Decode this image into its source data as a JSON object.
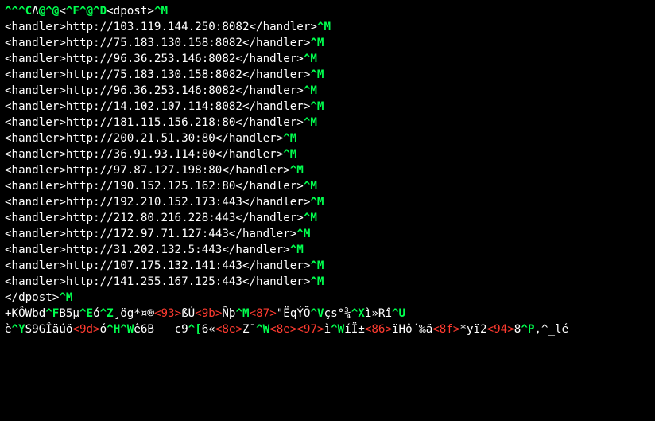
{
  "lines": [
    [
      {
        "cls": "g",
        "t": "^^^C"
      },
      {
        "cls": "w",
        "t": "Ʌ"
      },
      {
        "cls": "g",
        "t": "@^@"
      },
      {
        "cls": "w",
        "t": "<"
      },
      {
        "cls": "g",
        "t": "^F^@^D"
      },
      {
        "cls": "w",
        "t": "<dpost>"
      },
      {
        "cls": "g",
        "t": "^M"
      }
    ],
    [
      {
        "cls": "w",
        "t": "<handler>http://103.119.144.250:8082</handler>"
      },
      {
        "cls": "g",
        "t": "^M"
      }
    ],
    [
      {
        "cls": "w",
        "t": "<handler>http://75.183.130.158:8082</handler>"
      },
      {
        "cls": "g",
        "t": "^M"
      }
    ],
    [
      {
        "cls": "w",
        "t": "<handler>http://96.36.253.146:8082</handler>"
      },
      {
        "cls": "g",
        "t": "^M"
      }
    ],
    [
      {
        "cls": "w",
        "t": "<handler>http://75.183.130.158:8082</handler>"
      },
      {
        "cls": "g",
        "t": "^M"
      }
    ],
    [
      {
        "cls": "w",
        "t": "<handler>http://96.36.253.146:8082</handler>"
      },
      {
        "cls": "g",
        "t": "^M"
      }
    ],
    [
      {
        "cls": "w",
        "t": "<handler>http://14.102.107.114:8082</handler>"
      },
      {
        "cls": "g",
        "t": "^M"
      }
    ],
    [
      {
        "cls": "w",
        "t": "<handler>http://181.115.156.218:80</handler>"
      },
      {
        "cls": "g",
        "t": "^M"
      }
    ],
    [
      {
        "cls": "w",
        "t": "<handler>http://200.21.51.30:80</handler>"
      },
      {
        "cls": "g",
        "t": "^M"
      }
    ],
    [
      {
        "cls": "w",
        "t": "<handler>http://36.91.93.114:80</handler>"
      },
      {
        "cls": "g",
        "t": "^M"
      }
    ],
    [
      {
        "cls": "w",
        "t": "<handler>http://97.87.127.198:80</handler>"
      },
      {
        "cls": "g",
        "t": "^M"
      }
    ],
    [
      {
        "cls": "w",
        "t": "<handler>http://190.152.125.162:80</handler>"
      },
      {
        "cls": "g",
        "t": "^M"
      }
    ],
    [
      {
        "cls": "w",
        "t": "<handler>http://192.210.152.173:443</handler>"
      },
      {
        "cls": "g",
        "t": "^M"
      }
    ],
    [
      {
        "cls": "w",
        "t": "<handler>http://212.80.216.228:443</handler>"
      },
      {
        "cls": "g",
        "t": "^M"
      }
    ],
    [
      {
        "cls": "w",
        "t": "<handler>http://172.97.71.127:443</handler>"
      },
      {
        "cls": "g",
        "t": "^M"
      }
    ],
    [
      {
        "cls": "w",
        "t": "<handler>http://31.202.132.5:443</handler>"
      },
      {
        "cls": "g",
        "t": "^M"
      }
    ],
    [
      {
        "cls": "w",
        "t": "<handler>http://107.175.132.141:443</handler>"
      },
      {
        "cls": "g",
        "t": "^M"
      }
    ],
    [
      {
        "cls": "w",
        "t": "<handler>http://141.255.167.125:443</handler>"
      },
      {
        "cls": "g",
        "t": "^M"
      }
    ],
    [
      {
        "cls": "w",
        "t": "</dpost>"
      },
      {
        "cls": "g",
        "t": "^M"
      }
    ],
    [
      {
        "cls": "w",
        "t": "+KÔWbd"
      },
      {
        "cls": "g",
        "t": "^F"
      },
      {
        "cls": "w",
        "t": "B5µ"
      },
      {
        "cls": "g",
        "t": "^E"
      },
      {
        "cls": "w",
        "t": "ó"
      },
      {
        "cls": "g",
        "t": "^Z"
      },
      {
        "cls": "w",
        "t": "¸ög*¤®"
      },
      {
        "cls": "r",
        "t": "<93>"
      },
      {
        "cls": "w",
        "t": "ßÚ"
      },
      {
        "cls": "r",
        "t": "<9b>"
      },
      {
        "cls": "w",
        "t": "Ñþ"
      },
      {
        "cls": "g",
        "t": "^M"
      },
      {
        "cls": "r",
        "t": "<87>"
      },
      {
        "cls": "w",
        "t": "\"ËqÝÕ"
      },
      {
        "cls": "g",
        "t": "^V"
      },
      {
        "cls": "w",
        "t": "çs°¾"
      },
      {
        "cls": "g",
        "t": "^X"
      },
      {
        "cls": "w",
        "t": "ì»Rî"
      },
      {
        "cls": "g",
        "t": "^U"
      }
    ],
    [
      {
        "cls": "w",
        "t": "è"
      },
      {
        "cls": "g",
        "t": "^Y"
      },
      {
        "cls": "w",
        "t": "S9GÎäúö"
      },
      {
        "cls": "r",
        "t": "<9d>"
      },
      {
        "cls": "w",
        "t": "ó"
      },
      {
        "cls": "g",
        "t": "^H^W"
      },
      {
        "cls": "w",
        "t": "ê6B   c9"
      },
      {
        "cls": "g",
        "t": "^["
      },
      {
        "cls": "w",
        "t": "6«"
      },
      {
        "cls": "r",
        "t": "<8e>"
      },
      {
        "cls": "w",
        "t": "Z¯"
      },
      {
        "cls": "g",
        "t": "^W"
      },
      {
        "cls": "r",
        "t": "<8e>"
      },
      {
        "cls": "r",
        "t": "<97>"
      },
      {
        "cls": "w",
        "t": "ì"
      },
      {
        "cls": "g",
        "t": "^W"
      },
      {
        "cls": "w",
        "t": "íÏ±"
      },
      {
        "cls": "r",
        "t": "<86>"
      },
      {
        "cls": "w",
        "t": "ïHô´‰ä"
      },
      {
        "cls": "r",
        "t": "<8f>"
      },
      {
        "cls": "w",
        "t": "*yï2"
      },
      {
        "cls": "r",
        "t": "<94>"
      },
      {
        "cls": "w",
        "t": "8"
      },
      {
        "cls": "g",
        "t": "^P"
      },
      {
        "cls": "w",
        "t": ",^_lé"
      }
    ]
  ]
}
